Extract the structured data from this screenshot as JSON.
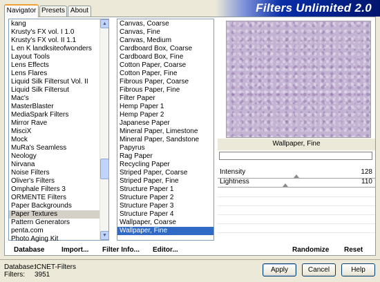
{
  "tabs": [
    {
      "label": "Navigator"
    },
    {
      "label": "Presets"
    },
    {
      "label": "About"
    }
  ],
  "banner_title": "Filters Unlimited 2.0",
  "categories": [
    "kang",
    "Krusty's FX vol. I 1.0",
    "Krusty's FX vol. II 1.1",
    "L en K landksiteofwonders",
    "Layout Tools",
    "Lens Effects",
    "Lens Flares",
    "Liquid Silk Filtersut Vol. II",
    "Liquid Silk Filtersut",
    "Mac's",
    "MasterBlaster",
    "MediaSpark Filters",
    "Mirror Rave",
    "MisciX",
    "Mock",
    "MuRa's Seamless",
    "Neology",
    "Nirvana",
    "Noise Filters",
    "Oliver's Filters",
    "Omphale Filters 3",
    "ORMENTE Filters",
    "Paper Backgrounds",
    "Paper Textures",
    "Pattern Generators",
    "penta.com",
    "Photo Aging Kit"
  ],
  "selected_category": "Paper Textures",
  "filters": [
    "Canvas, Coarse",
    "Canvas, Fine",
    "Canvas, Medium",
    "Cardboard Box, Coarse",
    "Cardboard Box, Fine",
    "Cotton Paper, Coarse",
    "Cotton Paper, Fine",
    "Fibrous Paper, Coarse",
    "Fibrous Paper, Fine",
    "Filter Paper",
    "Hemp Paper 1",
    "Hemp Paper 2",
    "Japanese Paper",
    "Mineral Paper, Limestone",
    "Mineral Paper, Sandstone",
    "Papyrus",
    "Rag Paper",
    "Recycling Paper",
    "Striped Paper, Coarse",
    "Striped Paper, Fine",
    "Structure Paper 1",
    "Structure Paper 2",
    "Structure Paper 3",
    "Structure Paper 4",
    "Wallpaper, Coarse",
    "Wallpaper, Fine"
  ],
  "selected_filter": "Wallpaper, Fine",
  "preview_label": "Wallpaper, Fine",
  "params": [
    {
      "name": "Intensity",
      "value": "128",
      "level": 0.5
    },
    {
      "name": "Lightness",
      "value": "110",
      "level": 0.43
    }
  ],
  "link_buttons": {
    "database": "Database",
    "import": "Import...",
    "filter_info": "Filter Info...",
    "editor": "Editor...",
    "randomize": "Randomize",
    "reset": "Reset"
  },
  "db_info": {
    "database_key": "Database:",
    "database_val": "ICNET-Filters",
    "filters_key": "Filters:",
    "filters_val": "3951"
  },
  "buttons": {
    "apply": "Apply",
    "cancel": "Cancel",
    "help": "Help"
  },
  "colors": {
    "selection_blue": "#316ac5",
    "selection_grey": "#d4d0c8",
    "preview_texture": "#c4b4d4",
    "banner": "#00156e"
  }
}
